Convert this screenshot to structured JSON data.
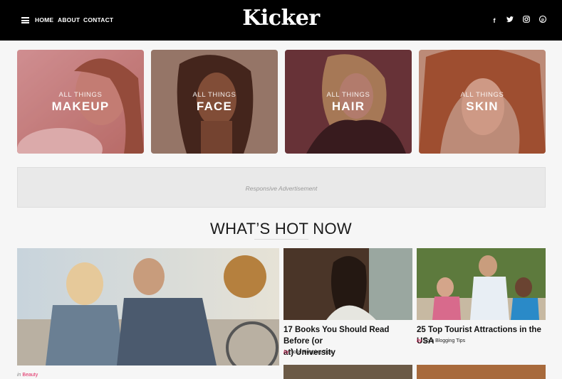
{
  "header": {
    "logo": "Kicker",
    "nav": [
      "HOME",
      "ABOUT",
      "CONTACT"
    ],
    "social_icons": [
      "facebook-icon",
      "twitter-icon",
      "instagram-icon",
      "pinterest-icon"
    ]
  },
  "categories": [
    {
      "small": "ALL THINGS",
      "big": "MAKEUP"
    },
    {
      "small": "ALL THINGS",
      "big": "FACE"
    },
    {
      "small": "ALL THINGS",
      "big": "HAIR"
    },
    {
      "small": "ALL THINGS",
      "big": "SKIN"
    }
  ],
  "ad": {
    "text": "Responsive Advertisement"
  },
  "section": {
    "title": "WHAT’S HOT NOW"
  },
  "featured": {
    "prefix": "in",
    "category": "Beauty"
  },
  "posts": [
    {
      "title_line1": "17 Books You Should Read Before (or",
      "title_line2": "at) University",
      "by": "by",
      "author": "Sora Blogging Tips"
    },
    {
      "title_line1": "25 Top Tourist Attractions in the USA",
      "by": "by",
      "author": "Sora Blogging Tips"
    }
  ],
  "colors": {
    "accent": "#e0245e",
    "header_bg": "#000000"
  }
}
